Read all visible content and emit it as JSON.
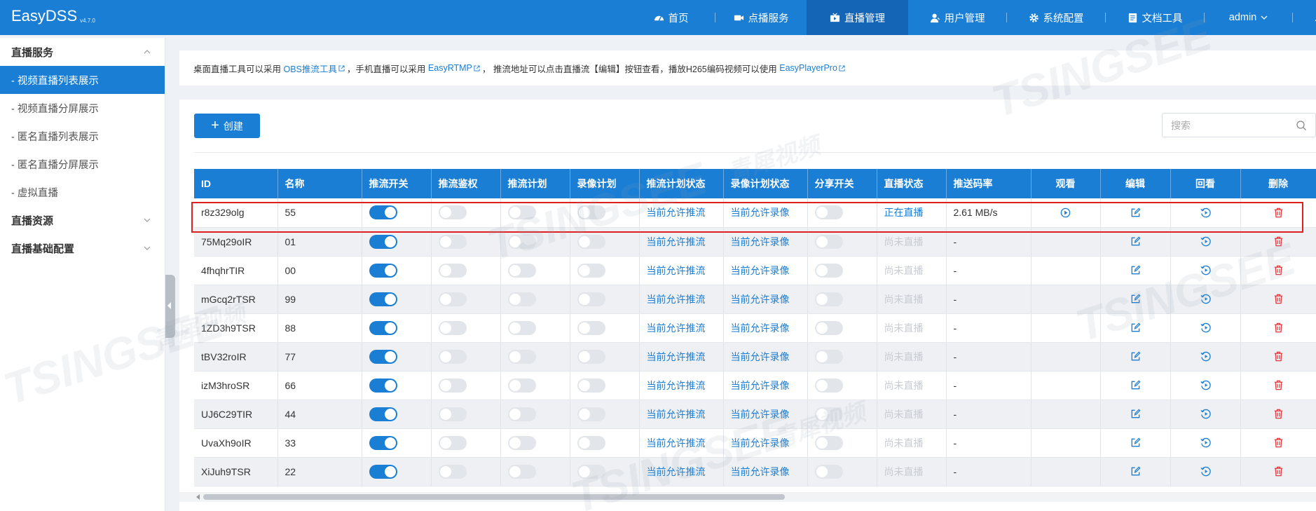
{
  "app": {
    "title": "EasyDSS",
    "version": "v4.7.0"
  },
  "nav": {
    "items": [
      {
        "label": "首页",
        "icon": "dashboard-icon"
      },
      {
        "label": "点播服务",
        "icon": "video-camera-icon"
      },
      {
        "label": "直播管理",
        "icon": "live-broadcast-icon"
      },
      {
        "label": "用户管理",
        "icon": "user-icon"
      },
      {
        "label": "系统配置",
        "icon": "gear-icon"
      },
      {
        "label": "文档工具",
        "icon": "document-icon"
      }
    ],
    "active": "直播管理",
    "user": "admin"
  },
  "sidebar": {
    "group1": "直播服务",
    "items": [
      "- 视频直播列表展示",
      "- 视频直播分屏展示",
      "- 匿名直播列表展示",
      "- 匿名直播分屏展示",
      "- 虚拟直播"
    ],
    "group2": "直播资源",
    "group3": "直播基础配置"
  },
  "notice": {
    "t1": "桌面直播工具可以采用",
    "l1": "OBS推流工具",
    "t2": "，手机直播可以采用",
    "l2": "EasyRTMP",
    "t3": "，  推流地址可以点击直播流【编辑】按钮查看，播放H265编码视频可以使用",
    "l3": "EasyPlayerPro"
  },
  "toolbar": {
    "create_label": "创建",
    "search_placeholder": "搜索"
  },
  "table": {
    "headers": [
      "ID",
      "名称",
      "推流开关",
      "推流鉴权",
      "推流计划",
      "录像计划",
      "推流计划状态",
      "录像计划状态",
      "分享开关",
      "直播状态",
      "推送码率",
      "观看",
      "编辑",
      "回看",
      "删除"
    ],
    "rows": [
      {
        "id": "r8z329olg",
        "name": "55",
        "push": true,
        "auth": false,
        "plan": false,
        "rec": false,
        "plan_status": "当前允许推流",
        "rec_status": "当前允许录像",
        "share": false,
        "live_status": "正在直播",
        "live": true,
        "bitrate": "2.61 MB/s"
      },
      {
        "id": "75Mq29oIR",
        "name": "01",
        "push": true,
        "auth": false,
        "plan": false,
        "rec": false,
        "plan_status": "当前允许推流",
        "rec_status": "当前允许录像",
        "share": false,
        "live_status": "尚未直播",
        "live": false,
        "bitrate": "-"
      },
      {
        "id": "4fhqhrTIR",
        "name": "00",
        "push": true,
        "auth": false,
        "plan": false,
        "rec": false,
        "plan_status": "当前允许推流",
        "rec_status": "当前允许录像",
        "share": false,
        "live_status": "尚未直播",
        "live": false,
        "bitrate": "-"
      },
      {
        "id": "mGcq2rTSR",
        "name": "99",
        "push": true,
        "auth": false,
        "plan": false,
        "rec": false,
        "plan_status": "当前允许推流",
        "rec_status": "当前允许录像",
        "share": false,
        "live_status": "尚未直播",
        "live": false,
        "bitrate": "-"
      },
      {
        "id": "1ZD3h9TSR",
        "name": "88",
        "push": true,
        "auth": false,
        "plan": false,
        "rec": false,
        "plan_status": "当前允许推流",
        "rec_status": "当前允许录像",
        "share": false,
        "live_status": "尚未直播",
        "live": false,
        "bitrate": "-"
      },
      {
        "id": "tBV32roIR",
        "name": "77",
        "push": true,
        "auth": false,
        "plan": false,
        "rec": false,
        "plan_status": "当前允许推流",
        "rec_status": "当前允许录像",
        "share": false,
        "live_status": "尚未直播",
        "live": false,
        "bitrate": "-"
      },
      {
        "id": "izM3hroSR",
        "name": "66",
        "push": true,
        "auth": false,
        "plan": false,
        "rec": false,
        "plan_status": "当前允许推流",
        "rec_status": "当前允许录像",
        "share": false,
        "live_status": "尚未直播",
        "live": false,
        "bitrate": "-"
      },
      {
        "id": "UJ6C29TIR",
        "name": "44",
        "push": true,
        "auth": false,
        "plan": false,
        "rec": false,
        "plan_status": "当前允许推流",
        "rec_status": "当前允许录像",
        "share": false,
        "live_status": "尚未直播",
        "live": false,
        "bitrate": "-"
      },
      {
        "id": "UvaXh9oIR",
        "name": "33",
        "push": true,
        "auth": false,
        "plan": false,
        "rec": false,
        "plan_status": "当前允许推流",
        "rec_status": "当前允许录像",
        "share": false,
        "live_status": "尚未直播",
        "live": false,
        "bitrate": "-"
      },
      {
        "id": "XiJuh9TSR",
        "name": "22",
        "push": true,
        "auth": false,
        "plan": false,
        "rec": false,
        "plan_status": "当前允许推流",
        "rec_status": "当前允许录像",
        "share": false,
        "live_status": "尚未直播",
        "live": false,
        "bitrate": "-"
      }
    ]
  },
  "watermark": [
    "TSINGSEE",
    "青犀视频"
  ],
  "colors": {
    "primary": "#1a7ed4",
    "nav_active": "#1565b6",
    "danger": "#e02020",
    "delete_icon": "#e0393e"
  }
}
